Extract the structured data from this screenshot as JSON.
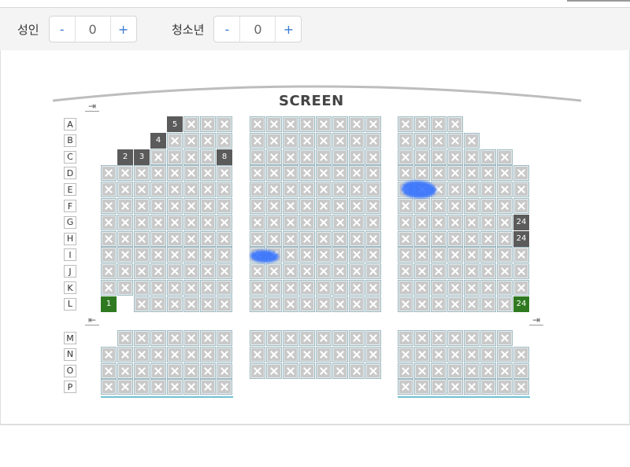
{
  "tickets": [
    {
      "label": "성인",
      "minus": "-",
      "value": "0",
      "plus": "+"
    },
    {
      "label": "청소년",
      "minus": "-",
      "value": "0",
      "plus": "+"
    }
  ],
  "screen_label": "SCREEN",
  "rows": [
    "A",
    "B",
    "C",
    "D",
    "E",
    "F",
    "G",
    "H",
    "I",
    "J",
    "K",
    "L",
    "M",
    "N",
    "O",
    "P"
  ],
  "doors": {
    "left_top": "⇥",
    "left_mid": "⇤",
    "right_mid": "⇥"
  },
  "seat_numbers": {
    "A5": "5",
    "B4": "4",
    "C2": "2",
    "C3": "3",
    "C8": "8",
    "G24": "24",
    "H24": "24",
    "L1": "1",
    "L24": "24"
  },
  "colors": {
    "available_green": "#2f7a21",
    "selected_dark": "#5b5b5b",
    "sold_gray": "#c9c9c9",
    "accent_blue": "#3a7bd5"
  }
}
